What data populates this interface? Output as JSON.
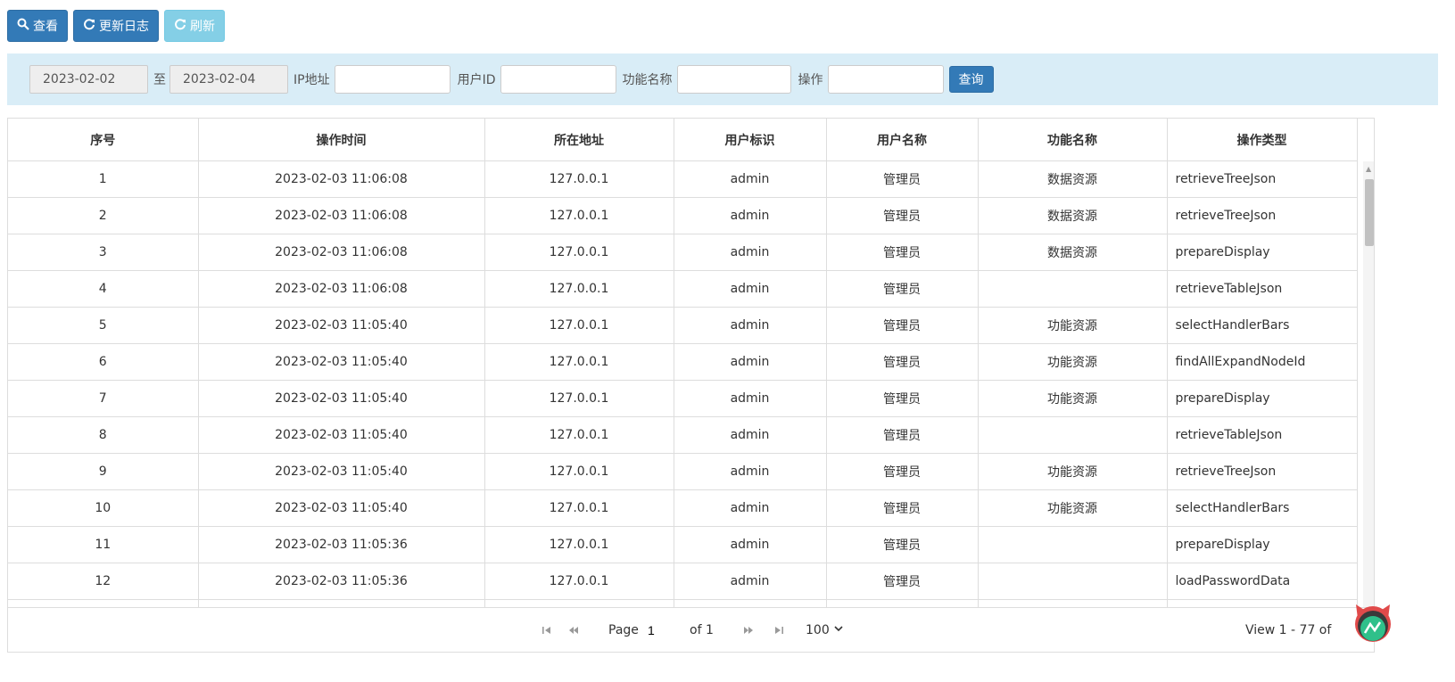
{
  "toolbar": {
    "view_label": "查看",
    "update_log_label": "更新日志",
    "refresh_label": "刷新"
  },
  "filter": {
    "date_from": "2023-02-02",
    "range_sep": "至",
    "date_to": "2023-02-04",
    "ip_label": "IP地址",
    "user_id_label": "用户ID",
    "function_label": "功能名称",
    "operation_label": "操作",
    "query_label": "查询"
  },
  "table": {
    "headers": [
      "序号",
      "操作时间",
      "所在地址",
      "用户标识",
      "用户名称",
      "功能名称",
      "操作类型"
    ],
    "rows": [
      {
        "no": "1",
        "time": "2023-02-03 11:06:08",
        "addr": "127.0.0.1",
        "uid": "admin",
        "uname": "管理员",
        "func": "数据资源",
        "op": "retrieveTreeJson"
      },
      {
        "no": "2",
        "time": "2023-02-03 11:06:08",
        "addr": "127.0.0.1",
        "uid": "admin",
        "uname": "管理员",
        "func": "数据资源",
        "op": "retrieveTreeJson"
      },
      {
        "no": "3",
        "time": "2023-02-03 11:06:08",
        "addr": "127.0.0.1",
        "uid": "admin",
        "uname": "管理员",
        "func": "数据资源",
        "op": "prepareDisplay"
      },
      {
        "no": "4",
        "time": "2023-02-03 11:06:08",
        "addr": "127.0.0.1",
        "uid": "admin",
        "uname": "管理员",
        "func": "",
        "op": "retrieveTableJson"
      },
      {
        "no": "5",
        "time": "2023-02-03 11:05:40",
        "addr": "127.0.0.1",
        "uid": "admin",
        "uname": "管理员",
        "func": "功能资源",
        "op": "selectHandlerBars"
      },
      {
        "no": "6",
        "time": "2023-02-03 11:05:40",
        "addr": "127.0.0.1",
        "uid": "admin",
        "uname": "管理员",
        "func": "功能资源",
        "op": "findAllExpandNodeId"
      },
      {
        "no": "7",
        "time": "2023-02-03 11:05:40",
        "addr": "127.0.0.1",
        "uid": "admin",
        "uname": "管理员",
        "func": "功能资源",
        "op": "prepareDisplay"
      },
      {
        "no": "8",
        "time": "2023-02-03 11:05:40",
        "addr": "127.0.0.1",
        "uid": "admin",
        "uname": "管理员",
        "func": "",
        "op": "retrieveTableJson"
      },
      {
        "no": "9",
        "time": "2023-02-03 11:05:40",
        "addr": "127.0.0.1",
        "uid": "admin",
        "uname": "管理员",
        "func": "功能资源",
        "op": "retrieveTreeJson"
      },
      {
        "no": "10",
        "time": "2023-02-03 11:05:40",
        "addr": "127.0.0.1",
        "uid": "admin",
        "uname": "管理员",
        "func": "功能资源",
        "op": "selectHandlerBars"
      },
      {
        "no": "11",
        "time": "2023-02-03 11:05:36",
        "addr": "127.0.0.1",
        "uid": "admin",
        "uname": "管理员",
        "func": "",
        "op": "prepareDisplay"
      },
      {
        "no": "12",
        "time": "2023-02-03 11:05:36",
        "addr": "127.0.0.1",
        "uid": "admin",
        "uname": "管理员",
        "func": "",
        "op": "loadPasswordData"
      }
    ]
  },
  "pager": {
    "page_label": "Page",
    "page_value": "1",
    "of_label": "of 1",
    "page_size": "100",
    "view_text": "View 1 - 77 of"
  },
  "colors": {
    "primary": "#337ab7",
    "info": "#5bc0de",
    "filter_bg": "#d9edf7",
    "border": "#dddddd"
  }
}
